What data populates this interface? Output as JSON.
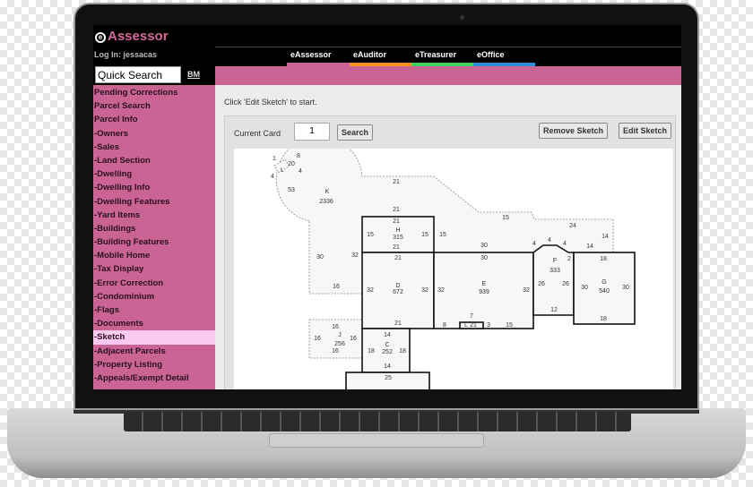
{
  "app": {
    "logo": "Assessor",
    "logo_mark": "e",
    "login": "Log In: jessacas",
    "quick_search": "Quick Search",
    "bm": "BM"
  },
  "tabs": [
    {
      "label": "eAssessor",
      "color": "#c96495"
    },
    {
      "label": "eAuditor",
      "color": "#f7941d"
    },
    {
      "label": "eTreasurer",
      "color": "#3fcf5c"
    },
    {
      "label": "eOffice",
      "color": "#2a8fd6"
    }
  ],
  "sidebar": {
    "selected": "-Sketch",
    "items": [
      "Pending Corrections",
      "Parcel Search",
      "Parcel Info",
      "-Owners",
      "-Sales",
      "-Land Section",
      "-Dwelling",
      "-Dwelling Info",
      "-Dwelling Features",
      "-Yard Items",
      "-Buildings",
      "-Building Features",
      "-Mobile Home",
      "-Tax Display",
      "-Error Correction",
      "-Condominium",
      "-Flags",
      "-Documents",
      "-Sketch",
      "-Adjacent Parcels",
      "-Property Listing",
      "-Appeals/Exempt Detail"
    ]
  },
  "main": {
    "hint": "Click 'Edit Sketch' to start.",
    "current_card_label": "Current Card",
    "current_card_value": "1",
    "search": "Search",
    "remove_sketch": "Remove Sketch",
    "edit_sketch": "Edit Sketch"
  },
  "sketch_labels": [
    "1",
    "4",
    "L",
    "20",
    "8",
    "4",
    "53",
    "K",
    "2336",
    "21",
    "21",
    "21",
    "21",
    "H",
    "315",
    "15",
    "15",
    "15",
    "30",
    "15",
    "24",
    "14",
    "4",
    "4",
    "4",
    "14",
    "30",
    "32",
    "2",
    "21",
    "30",
    "18",
    "F",
    "333",
    "D",
    "672",
    "E",
    "939",
    "32",
    "32",
    "32",
    "32",
    "26",
    "26",
    "30",
    "G",
    "540",
    "30",
    "16",
    "12",
    "18",
    "16",
    "21",
    "7",
    "8",
    "L",
    "21",
    "3",
    "15",
    "14",
    "16",
    "J",
    "256",
    "16",
    "16",
    "18",
    "C",
    "252",
    "18",
    "14",
    "25"
  ]
}
